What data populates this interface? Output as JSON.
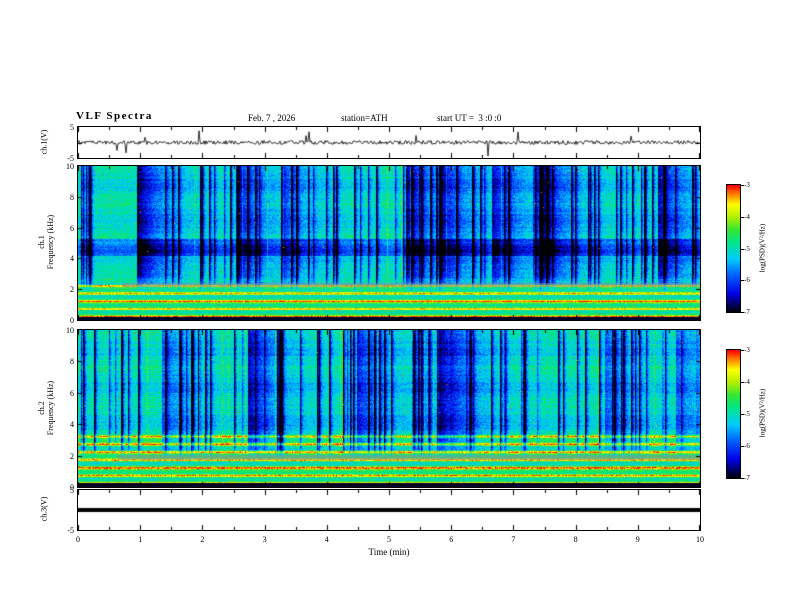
{
  "header": {
    "title": "VLF Spectra",
    "date": "Feb. 7 , 2026",
    "station": "station=ATH",
    "start_ut": "start UT =  3 :0 :0"
  },
  "xaxis": {
    "label": "Time (min)",
    "range": [
      0,
      10
    ],
    "ticks": [
      0,
      1,
      2,
      3,
      4,
      5,
      6,
      7,
      8,
      9,
      10
    ]
  },
  "chart_data": [
    {
      "type": "line",
      "panel": "ch1-waveform",
      "ylabel": "ch.1(V)",
      "ylim": [
        -5,
        5
      ],
      "yticks": [
        5,
        -5
      ],
      "series_desc": "broadband noise trace centered on 0 V with many impulsive spikes up to about +/-4 V"
    },
    {
      "type": "heatmap",
      "panel": "ch1-spectrogram",
      "ylabel": [
        "ch.1",
        "Frequency (kHz)"
      ],
      "ylim": [
        0,
        10
      ],
      "yticks": [
        10,
        8,
        6,
        4,
        2,
        0
      ],
      "xrange_min": [
        0,
        10
      ],
      "colorbar": {
        "label": "log(PSD)(V²/Hz)",
        "ticks": [
          -3,
          -4,
          -5,
          -6,
          -7
        ],
        "range": [
          -7,
          -3
        ]
      },
      "features": [
        "green background near -5 log PSD",
        "dense vertical dark-blue striations from impulsive broadband sferics",
        "yellow-red horizontal harmonic lines below ~2.3 kHz",
        "darker blue band near 4.2-5.3 kHz",
        "black band at 0-0.25 kHz",
        "scattered red speckles near 10 kHz"
      ]
    },
    {
      "type": "heatmap",
      "panel": "ch2-spectrogram",
      "ylabel": [
        "ch.2",
        "Frequency (kHz)"
      ],
      "ylim": [
        0,
        10
      ],
      "yticks": [
        10,
        8,
        6,
        4,
        2,
        0
      ],
      "xrange_min": [
        0,
        10
      ],
      "colorbar": {
        "label": "log(PSD)(V²/Hz)",
        "ticks": [
          -3,
          -4,
          -5,
          -6,
          -7
        ],
        "range": [
          -7,
          -3
        ]
      },
      "features": [
        "strong yellow-red horizontal harmonic lines up to ~3.6 kHz",
        "dense vertical dark-blue striations above ~3.6 kHz",
        "grey smeared horizontal band near 2 kHz",
        "black band at 0-0.3 kHz"
      ]
    },
    {
      "type": "line",
      "panel": "ch3-waveform",
      "ylabel": "ch.3(V)",
      "ylim": [
        -5,
        5
      ],
      "yticks": [
        5,
        -5
      ],
      "series_desc": "flat thick line at 0 V (channel off / no signal)"
    }
  ],
  "colors": {
    "background": "#ffffff",
    "frame": "#000000",
    "trace": "#000000",
    "colormap_stops": [
      {
        "p": 0.0,
        "c": "#000000"
      },
      {
        "p": 0.05,
        "c": "#00004d"
      },
      {
        "p": 0.15,
        "c": "#0000e6"
      },
      {
        "p": 0.3,
        "c": "#0066ff"
      },
      {
        "p": 0.42,
        "c": "#00ccff"
      },
      {
        "p": 0.55,
        "c": "#00e68a"
      },
      {
        "p": 0.65,
        "c": "#33e633"
      },
      {
        "p": 0.75,
        "c": "#b3f000"
      },
      {
        "p": 0.85,
        "c": "#ffff00"
      },
      {
        "p": 0.93,
        "c": "#ff8000"
      },
      {
        "p": 1.0,
        "c": "#ff0000"
      }
    ]
  }
}
